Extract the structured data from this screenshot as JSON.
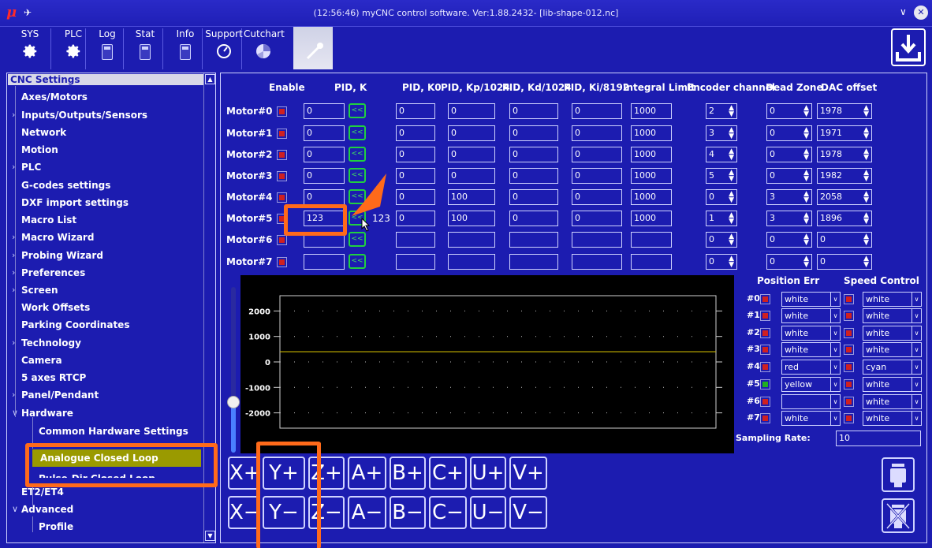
{
  "window": {
    "logo": "μ",
    "pin": "✈",
    "title": "(12:56:46) myCNC control software. Ver:1.88.2432- [lib-shape-012.nc]",
    "chevron": "∨",
    "close": "✕"
  },
  "topmenu": [
    {
      "label": "SYS",
      "icon": "gear-icon"
    },
    {
      "label": "PLC",
      "icon": "gear-icon"
    },
    {
      "label": "Log",
      "icon": "calculator-icon"
    },
    {
      "label": "Stat",
      "icon": "calculator-icon"
    },
    {
      "label": "Info",
      "icon": "calculator-icon"
    },
    {
      "label": "Support",
      "icon": "gauge-icon"
    },
    {
      "label": "Cutchart",
      "icon": "pie-chart-icon"
    }
  ],
  "sidebar": {
    "header": "CNC Settings",
    "items": [
      {
        "label": "Axes/Motors",
        "arrow": ""
      },
      {
        "label": "Inputs/Outputs/Sensors",
        "arrow": "›"
      },
      {
        "label": "Network",
        "arrow": ""
      },
      {
        "label": "Motion",
        "arrow": ""
      },
      {
        "label": "PLC",
        "arrow": "›"
      },
      {
        "label": "G-codes settings",
        "arrow": ""
      },
      {
        "label": "DXF import settings",
        "arrow": ""
      },
      {
        "label": "Macro List",
        "arrow": ""
      },
      {
        "label": "Macro Wizard",
        "arrow": "›"
      },
      {
        "label": "Probing Wizard",
        "arrow": "›"
      },
      {
        "label": "Preferences",
        "arrow": "›"
      },
      {
        "label": "Screen",
        "arrow": "›"
      },
      {
        "label": "Work Offsets",
        "arrow": ""
      },
      {
        "label": "Parking Coordinates",
        "arrow": ""
      },
      {
        "label": "Technology",
        "arrow": "›"
      },
      {
        "label": "Camera",
        "arrow": ""
      },
      {
        "label": "5 axes RTCP",
        "arrow": ""
      },
      {
        "label": "Panel/Pendant",
        "arrow": "›"
      },
      {
        "label": "Hardware",
        "arrow": "∨"
      },
      {
        "label": "Common Hardware Settings",
        "arrow": ""
      },
      {
        "label": "Analogue Closed Loop",
        "arrow": ""
      },
      {
        "label": "Pulse-Dir Closed Loop",
        "arrow": ""
      },
      {
        "label": "ET2/ET4",
        "arrow": ""
      },
      {
        "label": "Advanced",
        "arrow": "∨"
      },
      {
        "label": "Profile",
        "arrow": ""
      }
    ]
  },
  "table": {
    "headers": [
      "Enable",
      "PID, K",
      "PID, K0",
      "PID, Kp/1024",
      "PID, Kd/1024",
      "PID, Ki/8192",
      "Integral Limit",
      "Encoder channel",
      "Dead Zone",
      "DAC offset"
    ],
    "copy_label": "<<",
    "rows": [
      {
        "label": "Motor#0",
        "enabled": false,
        "k": "0",
        "k_copy": "",
        "k0": "0",
        "kp": "0",
        "kd": "0",
        "ki": "0",
        "ilimit": "1000",
        "enc": "2",
        "dead": "0",
        "dac": "1978"
      },
      {
        "label": "Motor#1",
        "enabled": false,
        "k": "0",
        "k_copy": "",
        "k0": "0",
        "kp": "0",
        "kd": "0",
        "ki": "0",
        "ilimit": "1000",
        "enc": "3",
        "dead": "0",
        "dac": "1971"
      },
      {
        "label": "Motor#2",
        "enabled": false,
        "k": "0",
        "k_copy": "",
        "k0": "0",
        "kp": "0",
        "kd": "0",
        "ki": "0",
        "ilimit": "1000",
        "enc": "4",
        "dead": "0",
        "dac": "1978"
      },
      {
        "label": "Motor#3",
        "enabled": false,
        "k": "0",
        "k_copy": "",
        "k0": "0",
        "kp": "0",
        "kd": "0",
        "ki": "0",
        "ilimit": "1000",
        "enc": "5",
        "dead": "0",
        "dac": "1982"
      },
      {
        "label": "Motor#4",
        "enabled": false,
        "k": "0",
        "k_copy": "",
        "k0": "0",
        "kp": "100",
        "kd": "0",
        "ki": "0",
        "ilimit": "1000",
        "enc": "0",
        "dead": "3",
        "dac": "2058"
      },
      {
        "label": "Motor#5",
        "enabled": false,
        "k": "123",
        "k_copy": "123",
        "k0": "0",
        "kp": "100",
        "kd": "0",
        "ki": "0",
        "ilimit": "1000",
        "enc": "1",
        "dead": "3",
        "dac": "1896"
      },
      {
        "label": "Motor#6",
        "enabled": false,
        "k": "",
        "k_copy": "",
        "k0": "",
        "kp": "",
        "kd": "",
        "ki": "",
        "ilimit": "",
        "enc": "0",
        "dead": "0",
        "dac": "0"
      },
      {
        "label": "Motor#7",
        "enabled": false,
        "k": "",
        "k_copy": "",
        "k0": "",
        "kp": "",
        "kd": "",
        "ki": "",
        "ilimit": "",
        "enc": "0",
        "dead": "0",
        "dac": "0"
      }
    ]
  },
  "plot": {
    "y_ticks": [
      "2000",
      "1000",
      "0",
      "-1000",
      "-2000"
    ],
    "y_values": [
      2000,
      1000,
      0,
      -1000,
      -2000
    ],
    "trace_value": 400,
    "ylim": [
      -2600,
      2600
    ],
    "background": "#000000",
    "trace_color": "#c8b400",
    "slider_level": 0.3
  },
  "channels": {
    "position_err_header": "Position Err",
    "speed_control_header": "Speed Control",
    "rows": [
      {
        "label": "#0",
        "pos_enabled": false,
        "pos_color": "white",
        "spd_enabled": false,
        "spd_color": "white"
      },
      {
        "label": "#1",
        "pos_enabled": false,
        "pos_color": "white",
        "spd_enabled": false,
        "spd_color": "white"
      },
      {
        "label": "#2",
        "pos_enabled": false,
        "pos_color": "white",
        "spd_enabled": false,
        "spd_color": "white"
      },
      {
        "label": "#3",
        "pos_enabled": false,
        "pos_color": "white",
        "spd_enabled": false,
        "spd_color": "white"
      },
      {
        "label": "#4",
        "pos_enabled": false,
        "pos_color": "red",
        "spd_enabled": false,
        "spd_color": "cyan"
      },
      {
        "label": "#5",
        "pos_enabled": true,
        "pos_color": "yellow",
        "spd_enabled": false,
        "spd_color": "white"
      },
      {
        "label": "#6",
        "pos_enabled": false,
        "pos_color": "",
        "spd_enabled": false,
        "spd_color": "white"
      },
      {
        "label": "#7",
        "pos_enabled": false,
        "pos_color": "white",
        "spd_enabled": false,
        "spd_color": "white"
      }
    ],
    "sampling_label": "Sampling Rate:",
    "sampling_value": "10"
  },
  "jog": {
    "plus": [
      "X+",
      "Y+",
      "Z+",
      "A+",
      "B+",
      "C+",
      "U+",
      "V+"
    ],
    "minus": [
      "X−",
      "Y−",
      "Z−",
      "A−",
      "B−",
      "C−",
      "U−",
      "V−"
    ]
  },
  "colors": {
    "background": "#1c1cb0",
    "selection": "#9a9a00",
    "annotation": "#ff6a1a",
    "copy_button": "#20d040"
  }
}
